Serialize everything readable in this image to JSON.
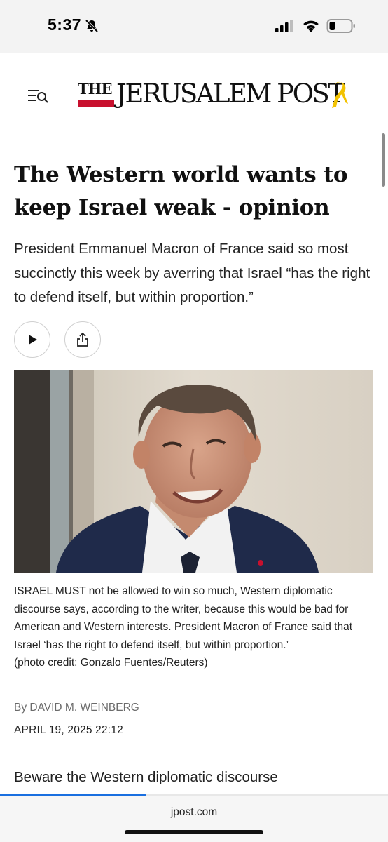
{
  "status_bar": {
    "time": "5:37",
    "icons": [
      "bell-slash-icon",
      "cellular-signal-icon",
      "wifi-icon",
      "battery-icon"
    ]
  },
  "header": {
    "logo": {
      "the": "THE",
      "name": "JERUSALEM POST"
    },
    "icons": [
      "menu-search-icon",
      "yellow-ribbon-icon"
    ],
    "colors": {
      "logo_red": "#c8102e",
      "ribbon_yellow": "#f2c200"
    }
  },
  "article": {
    "headline": "The Western world wants to keep Israel weak - opinion",
    "subheadline": "President Emmanuel Macron of France said so most succinctly this week by averring that Israel “has the right to defend itself, but within proportion.”",
    "actions": [
      "play-icon",
      "share-icon"
    ],
    "photo_caption": "ISRAEL MUST not be allowed to win so much, Western diplomatic discourse says, according to the writer, because this would be bad for American and Western interests. President Macron of France said that Israel ‘has the right to defend itself, but within proportion.’",
    "photo_credit": "(photo credit: Gonzalo Fuentes/Reuters)",
    "byline_prefix": "By",
    "author": "DAVID M. WEINBERG",
    "date": "APRIL 19, 2025 22:12",
    "body_start": "Beware the Western diplomatic discourse"
  },
  "browser": {
    "url": "jpost.com",
    "load_progress_fraction": 0.375,
    "accent": "#1a6fe0"
  }
}
